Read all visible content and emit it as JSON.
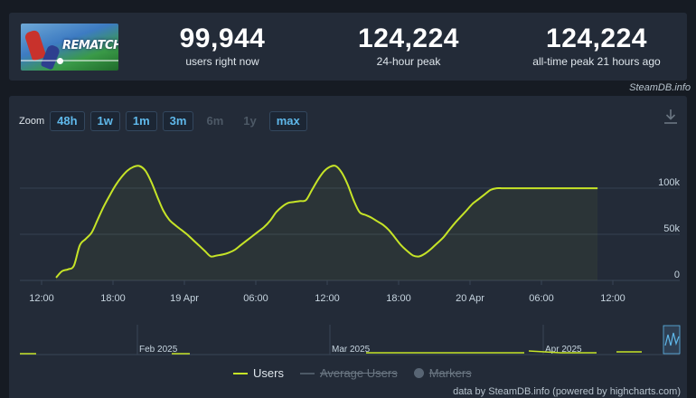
{
  "game": {
    "logo_text": "REMATCH"
  },
  "stats": [
    {
      "value": "99,944",
      "label": "users right now"
    },
    {
      "value": "124,224",
      "label": "24-hour peak"
    },
    {
      "value": "124,224",
      "label": "all-time peak 21 hours ago"
    }
  ],
  "source_tag": "SteamDB.info",
  "zoom": {
    "label": "Zoom",
    "buttons": [
      "48h",
      "1w",
      "1m",
      "3m",
      "6m",
      "1y",
      "max"
    ],
    "disabled": [
      "6m",
      "1y"
    ]
  },
  "download_icon": "download-icon",
  "legend": [
    {
      "label": "Users",
      "enabled": true
    },
    {
      "label": "Average Users",
      "enabled": false
    },
    {
      "label": "Markers",
      "enabled": false
    }
  ],
  "credit": "data by SteamDB.info (powered by highcharts.com)",
  "colors": {
    "series": "#c6e427",
    "accent": "#5fb8ea",
    "background": "#161b23",
    "panel": "#232b38"
  },
  "chart_data": {
    "type": "line",
    "series": [
      {
        "name": "Users",
        "x_hours": [
          0,
          0.5,
          1,
          1.5,
          2,
          2.5,
          3,
          3.5,
          4,
          4.5,
          5,
          5.5,
          6,
          6.5,
          7,
          7.5,
          8,
          8.5,
          9,
          9.5,
          10,
          10.5,
          11,
          11.5,
          12,
          12.5,
          13,
          13.5,
          14,
          14.5,
          15,
          15.5,
          16,
          16.5,
          17,
          17.5,
          18,
          18.5,
          19,
          19.5,
          20,
          20.5,
          21,
          21.5,
          22,
          22.5,
          23,
          23.5,
          24,
          24.5,
          25,
          25.5,
          26,
          26.5,
          27,
          27.5,
          28,
          28.5,
          29,
          29.5,
          30,
          30.5,
          31,
          31.5,
          32,
          32.5,
          33,
          33.5,
          34,
          34.5,
          35,
          35.5,
          36,
          36.5,
          37,
          37.5,
          38,
          38.5,
          39,
          39.5,
          40,
          40.5,
          41,
          41.5,
          42,
          42.5,
          43,
          43.5,
          44,
          44.5,
          45,
          45.5
        ],
        "values": [
          3000,
          10000,
          12000,
          16000,
          38000,
          45000,
          52000,
          66000,
          80000,
          92000,
          103000,
          112000,
          119000,
          123000,
          124000,
          119000,
          107000,
          91000,
          76000,
          66000,
          60000,
          55000,
          50000,
          44000,
          38000,
          32000,
          26000,
          27000,
          28000,
          30000,
          33000,
          38000,
          43000,
          48000,
          53000,
          58000,
          65000,
          74000,
          80000,
          84000,
          85000,
          86000,
          87000,
          98000,
          109000,
          118000,
          123000,
          124000,
          117000,
          104000,
          87000,
          74000,
          71000,
          68000,
          64000,
          60000,
          54000,
          46000,
          38000,
          32000,
          27000,
          26000,
          29000,
          34000,
          40000,
          46000,
          54000,
          62000,
          69000,
          76000,
          83000,
          88000,
          93000,
          98000,
          99944,
          99944,
          99944,
          99944,
          99944,
          99944,
          99944,
          99944,
          99944,
          99944,
          99944,
          99944,
          99944,
          99944,
          99944,
          99944,
          99944,
          99944
        ]
      }
    ],
    "x_tick_labels": [
      "12:00",
      "18:00",
      "19 Apr",
      "06:00",
      "12:00",
      "18:00",
      "20 Apr",
      "06:00",
      "12:00"
    ],
    "y_tick_labels": [
      "0",
      "50k",
      "100k"
    ],
    "ylim": [
      0,
      130000
    ],
    "navigator_labels": [
      "Feb 2025",
      "Mar 2025",
      "Apr 2025"
    ],
    "grid": true,
    "legend_placement": "bottom-center"
  }
}
